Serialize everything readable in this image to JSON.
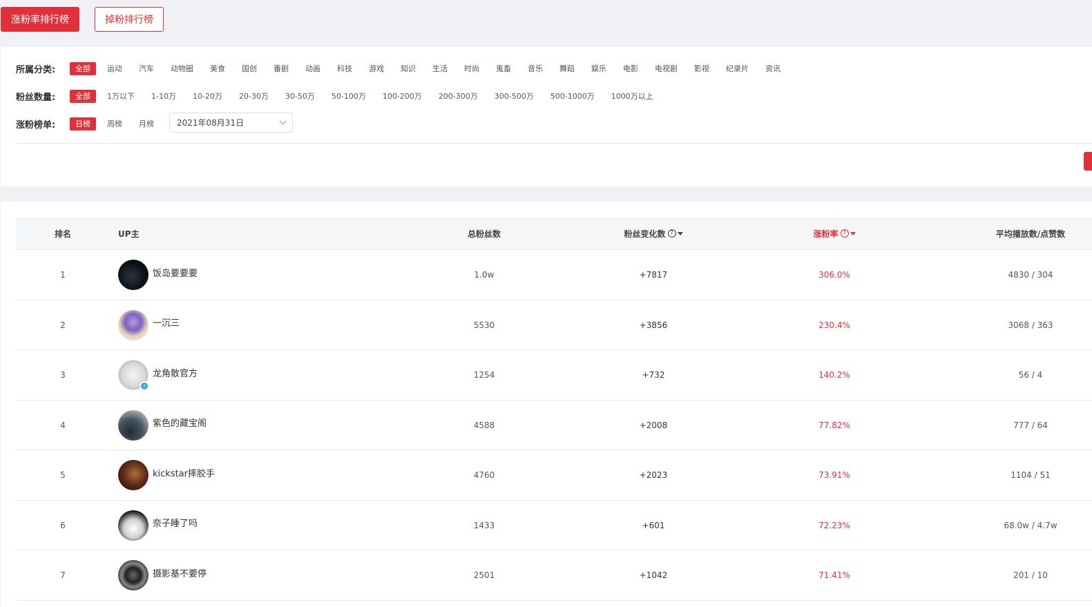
{
  "top_tabs": {
    "active": "涨粉率排行榜",
    "inactive": "掉粉排行榜"
  },
  "filters": {
    "category": {
      "label": "所属分类:",
      "options": [
        "全部",
        "运动",
        "汽车",
        "动物圈",
        "美食",
        "国创",
        "番剧",
        "动画",
        "科技",
        "游戏",
        "知识",
        "生活",
        "时尚",
        "鬼畜",
        "音乐",
        "舞蹈",
        "娱乐",
        "电影",
        "电视剧",
        "影视",
        "纪录片",
        "资讯"
      ],
      "selected": "全部"
    },
    "fans": {
      "label": "粉丝数量:",
      "options": [
        "全部",
        "1万以下",
        "1-10万",
        "10-20万",
        "20-30万",
        "30-50万",
        "50-100万",
        "100-200万",
        "200-300万",
        "300-500万",
        "500-1000万",
        "1000万以上"
      ],
      "selected": "全部"
    },
    "board": {
      "label": "涨粉榜单:",
      "options": [
        "日榜",
        "周榜",
        "月榜"
      ],
      "selected": "日榜",
      "date": "2021年08月31日"
    }
  },
  "table": {
    "headers": {
      "rank": "排名",
      "up": "UP主",
      "fans": "总粉丝数",
      "change": "粉丝变化数",
      "rate": "涨粉率",
      "avg": "平均播放数/点赞数"
    },
    "rows": [
      {
        "rank": "1",
        "name": "饭岛要要要",
        "fans": "1.0w",
        "change": "+7817",
        "rate": "306.0%",
        "avg": "4830 / 304",
        "avatar": "av1",
        "verified": false
      },
      {
        "rank": "2",
        "name": "一沉三",
        "fans": "5530",
        "change": "+3856",
        "rate": "230.4%",
        "avg": "3068 / 363",
        "avatar": "av2",
        "verified": false
      },
      {
        "rank": "3",
        "name": "龙角散官方",
        "fans": "1254",
        "change": "+732",
        "rate": "140.2%",
        "avg": "56 / 4",
        "avatar": "av3",
        "verified": true
      },
      {
        "rank": "4",
        "name": "紫色的藏宝阁",
        "fans": "4588",
        "change": "+2008",
        "rate": "77.82%",
        "avg": "777 / 64",
        "avatar": "av4",
        "verified": false
      },
      {
        "rank": "5",
        "name": "kickstar摔胶手",
        "fans": "4760",
        "change": "+2023",
        "rate": "73.91%",
        "avg": "1104 / 51",
        "avatar": "av5",
        "verified": false
      },
      {
        "rank": "6",
        "name": "奈子睡了吗",
        "fans": "1433",
        "change": "+601",
        "rate": "72.23%",
        "avg": "68.0w / 4.7w",
        "avatar": "av6",
        "verified": false
      },
      {
        "rank": "7",
        "name": "摄影基不要停",
        "fans": "2501",
        "change": "+1042",
        "rate": "71.41%",
        "avg": "201 / 10",
        "avatar": "av7",
        "verified": false
      }
    ]
  },
  "colors": {
    "accent": "#e0313a",
    "background": "#f0f1f4"
  }
}
